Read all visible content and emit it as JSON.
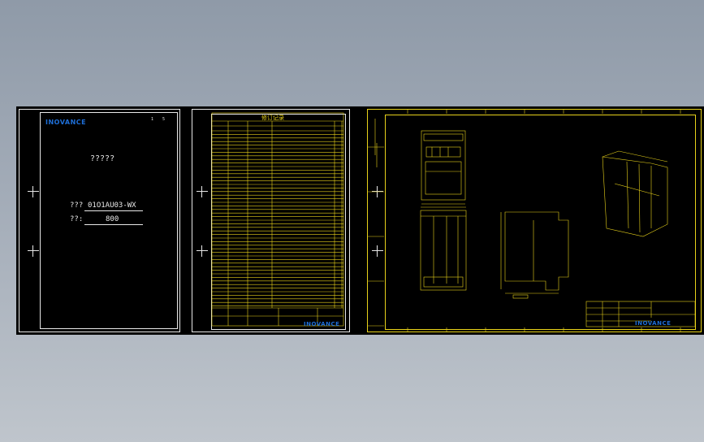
{
  "sheet1": {
    "logo": "INOVANCE",
    "page_marks": [
      "1",
      "5"
    ],
    "title": "?????",
    "code_label": "???",
    "code_value": "01O1AU03-WX",
    "qty_label": "??:",
    "qty_value": "800"
  },
  "sheet2": {
    "header_title": "修订记录",
    "logo": "INOVANCE"
  },
  "sheet3": {
    "logo": "INOVANCE"
  },
  "colors": {
    "drawing_line": "#e8d21a",
    "frame_line": "#e8e8e8",
    "logo": "#1e6fd9",
    "background": "#000000"
  }
}
